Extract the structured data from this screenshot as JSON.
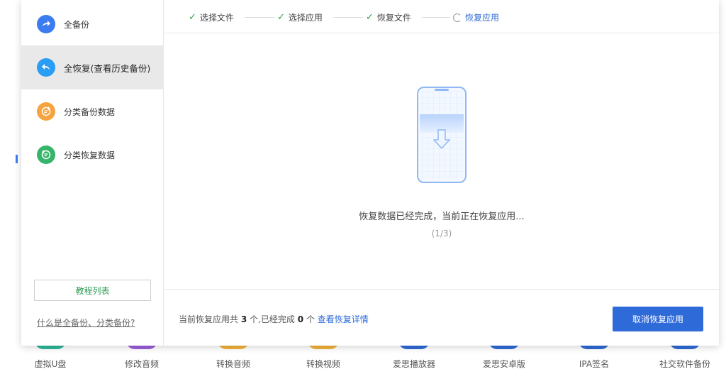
{
  "sidebar": {
    "items": [
      {
        "label": "全备份",
        "icon": "arrow-forward-icon",
        "color": "#3b7cf0"
      },
      {
        "label": "全恢复(查看历史备份)",
        "icon": "arrow-back-icon",
        "color": "#2a9df4"
      },
      {
        "label": "分类备份数据",
        "icon": "category-backup-icon",
        "color": "#f6a440"
      },
      {
        "label": "分类恢复数据",
        "icon": "category-restore-icon",
        "color": "#35b56a"
      }
    ],
    "active_index": 1,
    "tutorial_label": "教程列表",
    "faq_link": "什么是全备份、分类备份?"
  },
  "steps": [
    {
      "label": "选择文件",
      "state": "done"
    },
    {
      "label": "选择应用",
      "state": "done"
    },
    {
      "label": "恢复文件",
      "state": "done"
    },
    {
      "label": "恢复应用",
      "state": "current"
    }
  ],
  "main": {
    "status": "恢复数据已经完成，当前正在恢复应用...",
    "progress": "(1/3)"
  },
  "footer": {
    "prefix": "当前恢复应用共",
    "total": "3",
    "middle": "个,已经完成",
    "done": "0",
    "suffix": "个",
    "detail_link": "查看恢复详情",
    "cancel_label": "取消恢复应用"
  },
  "apps": [
    {
      "label": "虚拟U盘",
      "color": "#2fb89a"
    },
    {
      "label": "修改音频",
      "color": "#9b5fd8"
    },
    {
      "label": "转换音频",
      "color": "#f2b23a"
    },
    {
      "label": "转换视频",
      "color": "#f2b23a"
    },
    {
      "label": "爱思播放器",
      "color": "#2f6bd8"
    },
    {
      "label": "爱思安卓版",
      "color": "#2f6bd8"
    },
    {
      "label": "IPA签名",
      "color": "#2f6bd8"
    },
    {
      "label": "社交软件备份",
      "color": "#2f6bd8"
    }
  ],
  "colors": {
    "accent": "#2f6bd8",
    "success": "#2ba24c"
  }
}
